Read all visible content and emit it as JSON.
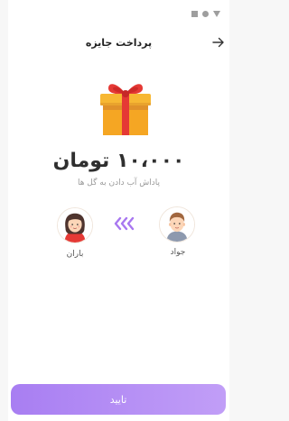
{
  "status_bar": {
    "icons": [
      "square-icon",
      "circle-icon",
      "triangle-icon"
    ]
  },
  "header": {
    "title": "پرداخت جایزه",
    "back_icon": "arrow-right-icon"
  },
  "gift": {
    "icon": "gift-box-icon"
  },
  "reward": {
    "amount": "۱۰،۰۰۰ تومان",
    "caption": "پاداش آب دادن به گل ها"
  },
  "transfer": {
    "sender": {
      "name": "جواد",
      "avatar_icon": "male-avatar-icon"
    },
    "receiver": {
      "name": "باران",
      "avatar_icon": "female-avatar-icon"
    },
    "direction_icon": "triple-chevron-left-icon"
  },
  "confirm_button": {
    "label": "تایید"
  },
  "colors": {
    "accent": "#b08af3",
    "gift_box": "#f5a623",
    "gift_ribbon": "#e53935",
    "text_primary": "#2f2f2f",
    "text_muted": "#9a9a9a"
  }
}
